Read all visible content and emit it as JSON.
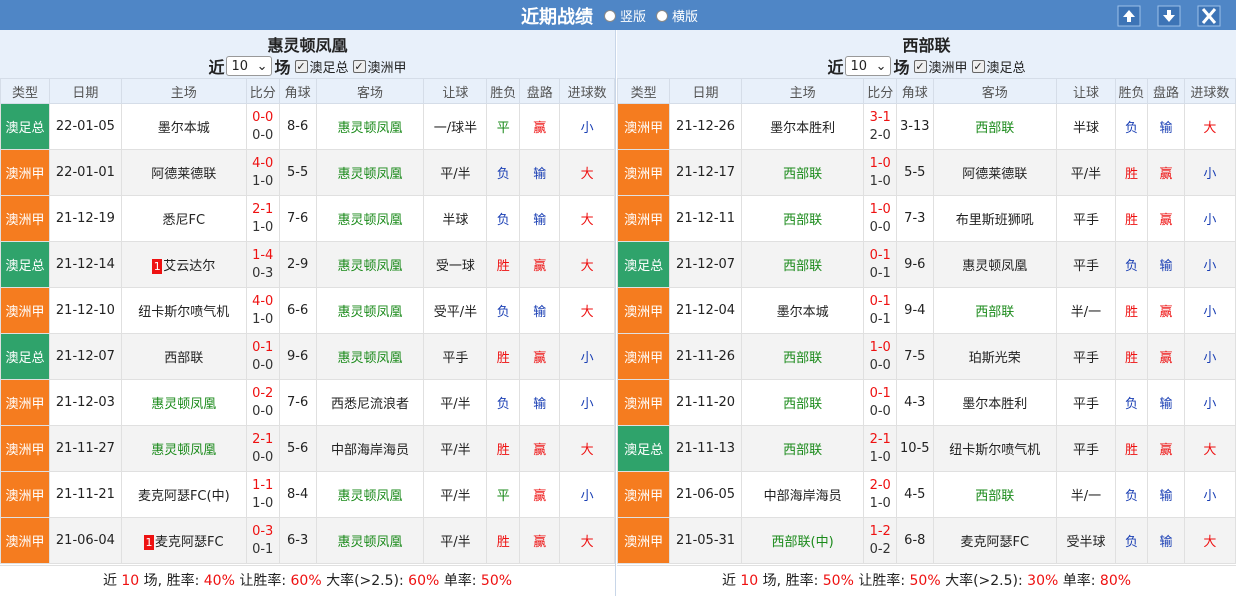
{
  "window": {
    "title": "近期战绩",
    "layout_options": [
      {
        "label": "竖版",
        "checked": false
      },
      {
        "label": "横版",
        "checked": false
      }
    ],
    "buttons": [
      "up-arrow-icon",
      "down-arrow-icon",
      "close-icon"
    ]
  },
  "colors": {
    "header_bar": "#4f86c6",
    "league_orange": "#f57c1f",
    "league_green": "#2fa36b",
    "red": "#e11111",
    "blue": "#1a3fb4",
    "green": "#1a8a1a"
  },
  "columns": [
    "类型",
    "日期",
    "主场",
    "比分",
    "角球",
    "客场",
    "让球",
    "胜负",
    "盘路",
    "进球数"
  ],
  "left": {
    "team": "惠灵顿凤凰",
    "filter": {
      "prefix": "近",
      "count": "10",
      "suffix": "场",
      "checks": [
        "澳足总",
        "澳洲甲"
      ]
    },
    "rows": [
      {
        "league": "澳足总",
        "lc": "g",
        "date": "22-01-05",
        "home": "墨尔本城",
        "hg": false,
        "hrc": "",
        "score": "0-0",
        "half": "0-0",
        "corner": "8-6",
        "away": "惠灵顿凤凰",
        "ag": true,
        "hcap": "一/球半",
        "res": "平",
        "rc": "draw",
        "pan": "赢",
        "pc": "win",
        "goals": "小",
        "gc": "small-b"
      },
      {
        "league": "澳洲甲",
        "lc": "o",
        "date": "22-01-01",
        "home": "阿德莱德联",
        "hg": false,
        "hrc": "",
        "score": "4-0",
        "half": "1-0",
        "corner": "5-5",
        "away": "惠灵顿凤凰",
        "ag": true,
        "hcap": "平/半",
        "res": "负",
        "rc": "lose",
        "pan": "输",
        "pc": "lose",
        "goals": "大",
        "gc": "big-r"
      },
      {
        "league": "澳洲甲",
        "lc": "o",
        "date": "21-12-19",
        "home": "悉尼FC",
        "hg": false,
        "hrc": "",
        "score": "2-1",
        "half": "1-0",
        "corner": "7-6",
        "away": "惠灵顿凤凰",
        "ag": true,
        "hcap": "半球",
        "res": "负",
        "rc": "lose",
        "pan": "输",
        "pc": "lose",
        "goals": "大",
        "gc": "big-r"
      },
      {
        "league": "澳足总",
        "lc": "g",
        "date": "21-12-14",
        "home": "艾云达尔",
        "hg": false,
        "hrc": "1",
        "score": "1-4",
        "half": "0-3",
        "corner": "2-9",
        "away": "惠灵顿凤凰",
        "ag": true,
        "hcap": "受一球",
        "res": "胜",
        "rc": "win",
        "pan": "赢",
        "pc": "win",
        "goals": "大",
        "gc": "big-r"
      },
      {
        "league": "澳洲甲",
        "lc": "o",
        "date": "21-12-10",
        "home": "纽卡斯尔喷气机",
        "hg": false,
        "hrc": "",
        "score": "4-0",
        "half": "1-0",
        "corner": "6-6",
        "away": "惠灵顿凤凰",
        "ag": true,
        "hcap": "受平/半",
        "res": "负",
        "rc": "lose",
        "pan": "输",
        "pc": "lose",
        "goals": "大",
        "gc": "big-r"
      },
      {
        "league": "澳足总",
        "lc": "g",
        "date": "21-12-07",
        "home": "西部联",
        "hg": false,
        "hrc": "",
        "score": "0-1",
        "half": "0-0",
        "corner": "9-6",
        "away": "惠灵顿凤凰",
        "ag": true,
        "hcap": "平手",
        "res": "胜",
        "rc": "win",
        "pan": "赢",
        "pc": "win",
        "goals": "小",
        "gc": "small-b"
      },
      {
        "league": "澳洲甲",
        "lc": "o",
        "date": "21-12-03",
        "home": "惠灵顿凤凰",
        "hg": true,
        "hrc": "",
        "score": "0-2",
        "half": "0-0",
        "corner": "7-6",
        "away": "西悉尼流浪者",
        "ag": false,
        "hcap": "平/半",
        "res": "负",
        "rc": "lose",
        "pan": "输",
        "pc": "lose",
        "goals": "小",
        "gc": "small-b"
      },
      {
        "league": "澳洲甲",
        "lc": "o",
        "date": "21-11-27",
        "home": "惠灵顿凤凰",
        "hg": true,
        "hrc": "",
        "score": "2-1",
        "half": "0-0",
        "corner": "5-6",
        "away": "中部海岸海员",
        "ag": false,
        "hcap": "平/半",
        "res": "胜",
        "rc": "win",
        "pan": "赢",
        "pc": "win",
        "goals": "大",
        "gc": "big-r"
      },
      {
        "league": "澳洲甲",
        "lc": "o",
        "date": "21-11-21",
        "home": "麦克阿瑟FC(中)",
        "hg": false,
        "hrc": "",
        "score": "1-1",
        "half": "1-0",
        "corner": "8-4",
        "away": "惠灵顿凤凰",
        "ag": true,
        "hcap": "平/半",
        "res": "平",
        "rc": "draw",
        "pan": "赢",
        "pc": "win",
        "goals": "小",
        "gc": "small-b"
      },
      {
        "league": "澳洲甲",
        "lc": "o",
        "date": "21-06-04",
        "home": "麦克阿瑟FC",
        "hg": false,
        "hrc": "1",
        "score": "0-3",
        "half": "0-1",
        "corner": "6-3",
        "away": "惠灵顿凤凰",
        "ag": true,
        "hcap": "平/半",
        "res": "胜",
        "rc": "win",
        "pan": "赢",
        "pc": "win",
        "goals": "大",
        "gc": "big-r"
      }
    ],
    "summary": {
      "t1": "近",
      "n": "10",
      "t2": "场, 胜率:",
      "win": "40%",
      "t3": "让胜率:",
      "hwin": "60%",
      "t4": "大率(>2.5):",
      "big": "60%",
      "t5": "单率:",
      "odd": "50%"
    }
  },
  "right": {
    "team": "西部联",
    "filter": {
      "prefix": "近",
      "count": "10",
      "suffix": "场",
      "checks": [
        "澳洲甲",
        "澳足总"
      ]
    },
    "rows": [
      {
        "league": "澳洲甲",
        "lc": "o",
        "date": "21-12-26",
        "home": "墨尔本胜利",
        "hg": false,
        "hrc": "",
        "score": "3-1",
        "half": "2-0",
        "corner": "3-13",
        "away": "西部联",
        "ag": true,
        "hcap": "半球",
        "res": "负",
        "rc": "lose",
        "pan": "输",
        "pc": "lose",
        "goals": "大",
        "gc": "big-r"
      },
      {
        "league": "澳洲甲",
        "lc": "o",
        "date": "21-12-17",
        "home": "西部联",
        "hg": true,
        "hrc": "",
        "score": "1-0",
        "half": "1-0",
        "corner": "5-5",
        "away": "阿德莱德联",
        "ag": false,
        "hcap": "平/半",
        "res": "胜",
        "rc": "win",
        "pan": "赢",
        "pc": "win",
        "goals": "小",
        "gc": "small-b"
      },
      {
        "league": "澳洲甲",
        "lc": "o",
        "date": "21-12-11",
        "home": "西部联",
        "hg": true,
        "hrc": "",
        "score": "1-0",
        "half": "0-0",
        "corner": "7-3",
        "away": "布里斯班狮吼",
        "ag": false,
        "hcap": "平手",
        "res": "胜",
        "rc": "win",
        "pan": "赢",
        "pc": "win",
        "goals": "小",
        "gc": "small-b"
      },
      {
        "league": "澳足总",
        "lc": "g",
        "date": "21-12-07",
        "home": "西部联",
        "hg": true,
        "hrc": "",
        "score": "0-1",
        "half": "0-1",
        "corner": "9-6",
        "away": "惠灵顿凤凰",
        "ag": false,
        "hcap": "平手",
        "res": "负",
        "rc": "lose",
        "pan": "输",
        "pc": "lose",
        "goals": "小",
        "gc": "small-b"
      },
      {
        "league": "澳洲甲",
        "lc": "o",
        "date": "21-12-04",
        "home": "墨尔本城",
        "hg": false,
        "hrc": "",
        "score": "0-1",
        "half": "0-1",
        "corner": "9-4",
        "away": "西部联",
        "ag": true,
        "hcap": "半/一",
        "res": "胜",
        "rc": "win",
        "pan": "赢",
        "pc": "win",
        "goals": "小",
        "gc": "small-b"
      },
      {
        "league": "澳洲甲",
        "lc": "o",
        "date": "21-11-26",
        "home": "西部联",
        "hg": true,
        "hrc": "",
        "score": "1-0",
        "half": "0-0",
        "corner": "7-5",
        "away": "珀斯光荣",
        "ag": false,
        "hcap": "平手",
        "res": "胜",
        "rc": "win",
        "pan": "赢",
        "pc": "win",
        "goals": "小",
        "gc": "small-b"
      },
      {
        "league": "澳洲甲",
        "lc": "o",
        "date": "21-11-20",
        "home": "西部联",
        "hg": true,
        "hrc": "",
        "score": "0-1",
        "half": "0-0",
        "corner": "4-3",
        "away": "墨尔本胜利",
        "ag": false,
        "hcap": "平手",
        "res": "负",
        "rc": "lose",
        "pan": "输",
        "pc": "lose",
        "goals": "小",
        "gc": "small-b"
      },
      {
        "league": "澳足总",
        "lc": "g",
        "date": "21-11-13",
        "home": "西部联",
        "hg": true,
        "hrc": "",
        "score": "2-1",
        "half": "1-0",
        "corner": "10-5",
        "away": "纽卡斯尔喷气机",
        "ag": false,
        "hcap": "平手",
        "res": "胜",
        "rc": "win",
        "pan": "赢",
        "pc": "win",
        "goals": "大",
        "gc": "big-r"
      },
      {
        "league": "澳洲甲",
        "lc": "o",
        "date": "21-06-05",
        "home": "中部海岸海员",
        "hg": false,
        "hrc": "",
        "score": "2-0",
        "half": "1-0",
        "corner": "4-5",
        "away": "西部联",
        "ag": true,
        "hcap": "半/一",
        "res": "负",
        "rc": "lose",
        "pan": "输",
        "pc": "lose",
        "goals": "小",
        "gc": "small-b"
      },
      {
        "league": "澳洲甲",
        "lc": "o",
        "date": "21-05-31",
        "home": "西部联(中)",
        "hg": true,
        "hrc": "",
        "score": "1-2",
        "half": "0-2",
        "corner": "6-8",
        "away": "麦克阿瑟FC",
        "ag": false,
        "hcap": "受半球",
        "res": "负",
        "rc": "lose",
        "pan": "输",
        "pc": "lose",
        "goals": "大",
        "gc": "big-r"
      }
    ],
    "summary": {
      "t1": "近",
      "n": "10",
      "t2": "场, 胜率:",
      "win": "50%",
      "t3": "让胜率:",
      "hwin": "50%",
      "t4": "大率(>2.5):",
      "big": "30%",
      "t5": "单率:",
      "odd": "80%"
    }
  }
}
